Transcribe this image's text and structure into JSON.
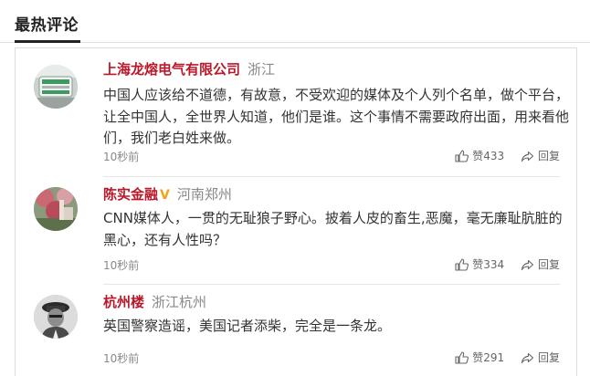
{
  "section": {
    "title": "最热评论"
  },
  "colors": {
    "username": "#b8182a",
    "location": "#888888",
    "verified": "#f2a21a",
    "text": "#333333"
  },
  "comments": [
    {
      "username": "上海龙熔电气有限公司",
      "location": "浙江",
      "verified": false,
      "content": "中国人应该给不道德，有故意，不受欢迎的媒体及个人列个名单，做个平台，让全中国人，全世界人知道，他们是谁。这个事情不需要政府出面，用来看他们，我们老白姓来做。",
      "time": "10秒前",
      "like_label": "赞433",
      "reply_label": "回复"
    },
    {
      "username": "陈实金融",
      "verified_mark": "V",
      "location": "河南郑州",
      "verified": true,
      "content": "CNN媒体人，一贯的无耻狼子野心。披着人皮的畜生,恶魔，毫无廉耻肮脏的黑心，还有人性吗？",
      "time": "10秒前",
      "like_label": "赞334",
      "reply_label": "回复"
    },
    {
      "username": "杭州楼",
      "location": "浙江杭州",
      "verified": false,
      "content": "英国警察造谣，美国记者添柴，完全是一条龙。",
      "time": "10秒前",
      "like_label": "赞291",
      "reply_label": "回复"
    }
  ]
}
